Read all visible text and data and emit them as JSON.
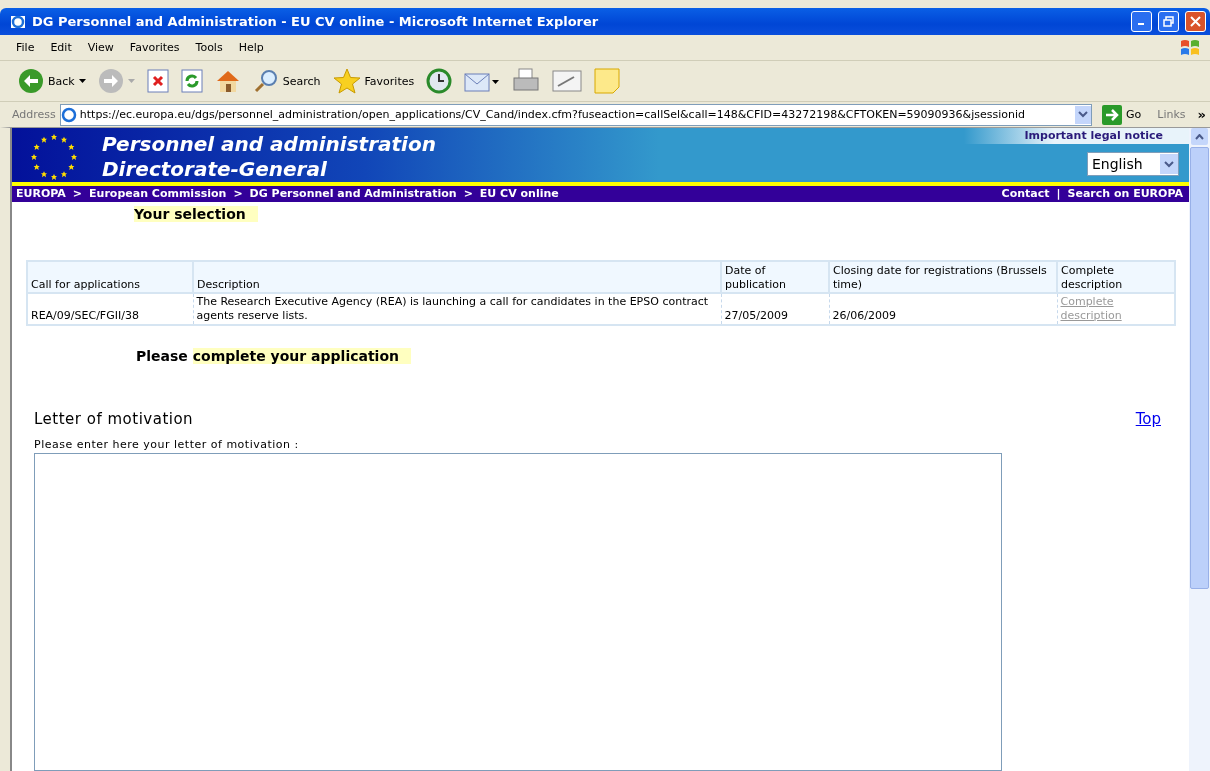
{
  "window": {
    "title": "DG Personnel and Administration - EU CV online - Microsoft Internet Explorer"
  },
  "menu": [
    "File",
    "Edit",
    "View",
    "Favorites",
    "Tools",
    "Help"
  ],
  "toolbar": [
    {
      "kind": "back",
      "label": "Back"
    },
    {
      "kind": "forward"
    },
    {
      "kind": "stop"
    },
    {
      "kind": "refresh"
    },
    {
      "kind": "home"
    },
    {
      "kind": "search",
      "label": "Search"
    },
    {
      "kind": "favorites",
      "label": "Favorites"
    },
    {
      "kind": "history"
    },
    {
      "kind": "mail"
    },
    {
      "kind": "print"
    },
    {
      "kind": "edit"
    },
    {
      "kind": "note"
    }
  ],
  "address": {
    "label": "Address",
    "url": "https://ec.europa.eu/dgs/personnel_administration/open_applications/CV_Cand/index.cfm?fuseaction=callSel&call=148&CFID=43272198&CFTOKEN=59090936&jsessionid",
    "go": "Go",
    "links": "Links",
    "more": "»"
  },
  "page": {
    "header": {
      "title_line_1": "Personnel and administration",
      "title_line_2": "Directorate-General",
      "legal_notice": "Important legal notice",
      "language": "English"
    },
    "breadcrumb": [
      {
        "label": "EUROPA",
        "separator": ">"
      },
      {
        "label": "European Commission",
        "separator": ">"
      },
      {
        "label": "DG Personnel and Administration",
        "separator": ">"
      },
      {
        "label": "EU CV online"
      }
    ],
    "top_links": [
      {
        "label": "Contact",
        "separator": "|"
      },
      {
        "label": "Search on EUROPA"
      }
    ],
    "selection_heading": "Your selection",
    "table": {
      "columns": [
        "Call for applications",
        "Description",
        "Date of publication",
        "Closing date for registrations (Brussels time)",
        "Complete description"
      ],
      "rows": [
        {
          "call": "REA/09/SEC/FGII/38",
          "description": "The Research Executive Agency (REA) is launching a call for candidates in the EPSO contract agents reserve lists.",
          "published": "27/05/2009",
          "closing": "26/06/2009",
          "link": "Complete description"
        }
      ]
    },
    "application_heading": {
      "lead": "Please",
      "rest": "complete your application"
    },
    "letter": {
      "heading": "Letter of motivation",
      "top_link": "Top",
      "prompt": "Please enter here your letter of motivation :"
    }
  }
}
